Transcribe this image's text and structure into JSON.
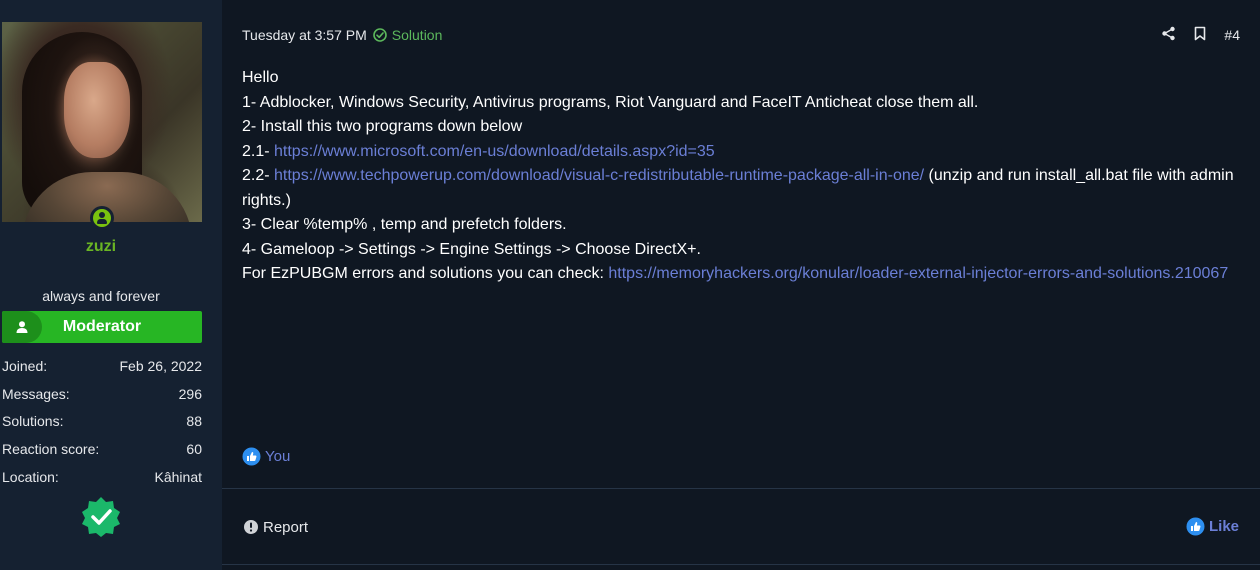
{
  "user": {
    "name": "zuzi",
    "title": "always and forever",
    "role": "Moderator",
    "stats": [
      {
        "label": "Joined:",
        "value": "Feb 26, 2022"
      },
      {
        "label": "Messages:",
        "value": "296"
      },
      {
        "label": "Solutions:",
        "value": "88"
      },
      {
        "label": "Reaction score:",
        "value": "60"
      },
      {
        "label": "Location:",
        "value": "Kâhinat"
      }
    ],
    "name_color": "#6ab524",
    "role_color": "#27b624"
  },
  "meta": {
    "date": "Tuesday at 3:57 PM",
    "solution_label": "Solution",
    "post_number": "#4"
  },
  "content": {
    "greeting": "Hello",
    "line1": "1- Adblocker, Windows Security, Antivirus programs, Riot Vanguard and FaceIT Anticheat close them all.",
    "line2": "2- Install this two programs down below",
    "line21_prefix": "2.1- ",
    "line21_link": "https://www.microsoft.com/en-us/download/details.aspx?id=35",
    "line22_prefix": "2.2- ",
    "line22_link": "https://www.techpowerup.com/download/visual-c-redistributable-runtime-package-all-in-one/",
    "line22_suffix": " (unzip and run install_all.bat file with admin rights.)",
    "line3": "3- Clear %temp% , temp and prefetch folders.",
    "line4": "4- Gameloop -> Settings -> Engine Settings -> Choose DirectX+.",
    "line5_prefix": "For EzPUBGM errors and solutions you can check: ",
    "line5_link": "https://memoryhackers.org/konular/loader-external-injector-errors-and-solutions.210067"
  },
  "reactions": {
    "by": "You"
  },
  "footer": {
    "report_label": "Report",
    "like_label": "Like"
  },
  "colors": {
    "link": "#6b7fd6",
    "solution": "#5cb85c",
    "background": "#0f1722",
    "sidebar": "#152131"
  }
}
